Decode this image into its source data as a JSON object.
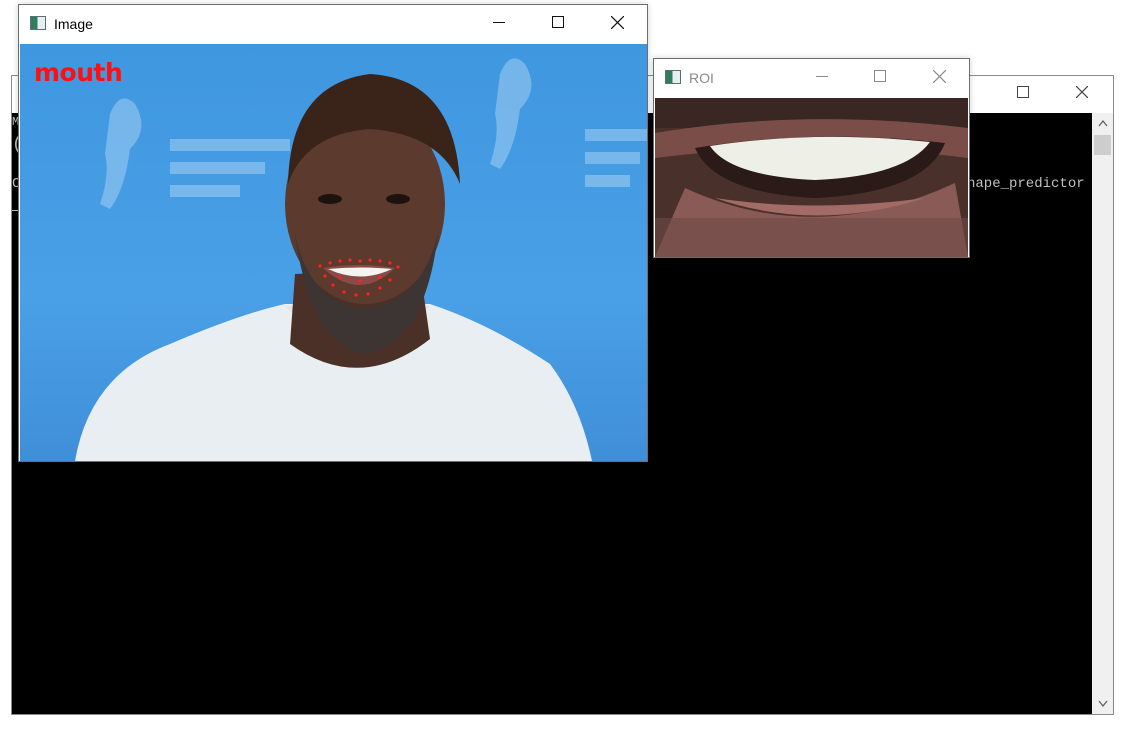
{
  "console": {
    "line1": "M",
    "line2": "(",
    "line3_left": "C",
    "line3_right": "hape_predictor",
    "scroll_up": "^",
    "scroll_down": "v"
  },
  "image_window": {
    "title": "Image",
    "overlay_label": "mouth",
    "overlay_color": "#ff1010",
    "icon": "app-window-icon"
  },
  "roi_window": {
    "title": "ROI",
    "icon": "app-window-icon"
  },
  "window_controls": {
    "minimize": "minimize-icon",
    "maximize": "maximize-icon",
    "close": "close-icon"
  }
}
